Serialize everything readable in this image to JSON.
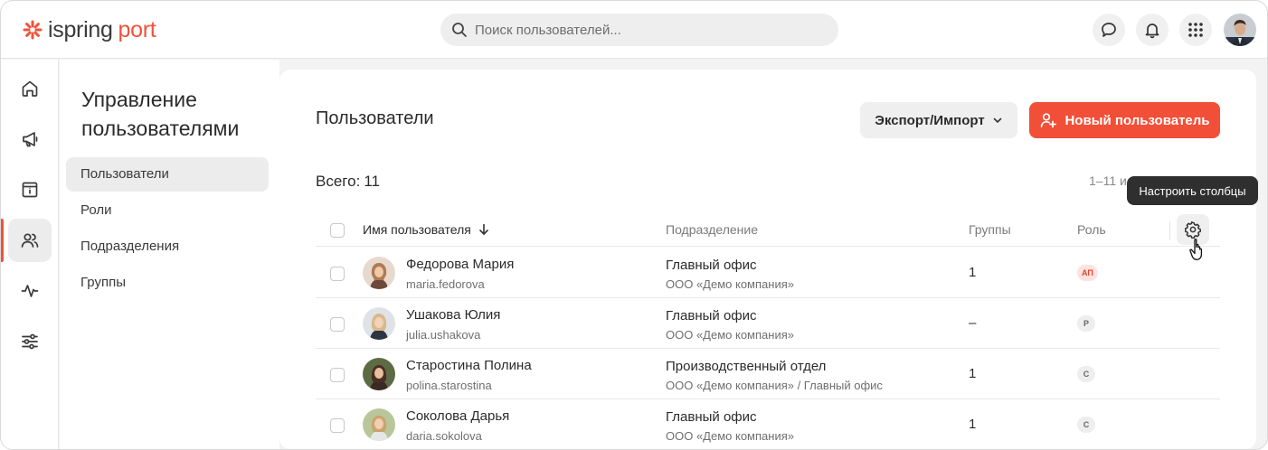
{
  "brand": {
    "name_a": "ispring",
    "name_b": "port",
    "accent": "#f0533a"
  },
  "search": {
    "placeholder": "Поиск пользователей..."
  },
  "header_icons": [
    "chat-icon",
    "bell-icon",
    "apps-grid-icon"
  ],
  "rail": {
    "items": [
      "home-icon",
      "megaphone-icon",
      "info-box-icon",
      "users-icon",
      "activity-icon",
      "sliders-icon"
    ],
    "active_index": 3
  },
  "section": {
    "title": "Управление пользователями",
    "items": [
      {
        "label": "Пользователи",
        "active": true
      },
      {
        "label": "Роли",
        "active": false
      },
      {
        "label": "Подразделения",
        "active": false
      },
      {
        "label": "Группы",
        "active": false
      }
    ]
  },
  "main": {
    "title": "Пользователи",
    "export_label": "Экспорт/Импорт",
    "new_user_label": "Новый пользователь",
    "total_label": "Всего:",
    "total_count": "11",
    "pager": "1–11 и",
    "tooltip": "Настроить столбцы"
  },
  "table": {
    "columns": {
      "name": "Имя пользователя",
      "department": "Подразделение",
      "groups": "Группы",
      "role": "Роль"
    },
    "rows": [
      {
        "name": "Федорова Мария",
        "login": "maria.fedorova",
        "department": "Главный офис",
        "org": "ООО «Демо компания»",
        "groups": "1",
        "role": "АП",
        "role_type": "admin"
      },
      {
        "name": "Ушакова Юлия",
        "login": "julia.ushakova",
        "department": "Главный офис",
        "org": "ООО «Демо компания»",
        "groups": "–",
        "role": "Р",
        "role_type": "normal"
      },
      {
        "name": "Старостина Полина",
        "login": "polina.starostina",
        "department": "Производственный отдел",
        "org": "ООО «Демо компания» / Главный офис",
        "groups": "1",
        "role": "С",
        "role_type": "normal"
      },
      {
        "name": "Соколова Дарья",
        "login": "daria.sokolova",
        "department": "Главный офис",
        "org": "ООО «Демо компания»",
        "groups": "1",
        "role": "С",
        "role_type": "normal"
      }
    ]
  }
}
